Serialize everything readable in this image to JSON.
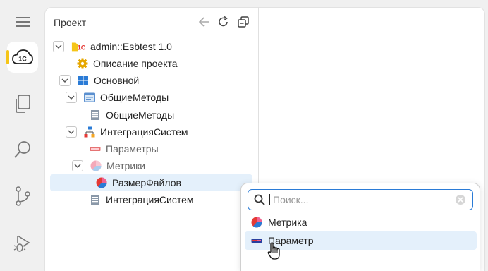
{
  "activity_bar": {
    "items": [
      {
        "name": "menu-icon"
      },
      {
        "name": "project-1c-icon",
        "label": "1C",
        "active": true
      },
      {
        "name": "files-icon"
      },
      {
        "name": "search-icon"
      },
      {
        "name": "source-control-icon"
      },
      {
        "name": "run-debug-icon"
      }
    ]
  },
  "panel": {
    "title": "Проект"
  },
  "tree": {
    "root_label": "admin::Esbtest 1.0",
    "root_badge": "1C",
    "desc_label": "Описание проекта",
    "main_label": "Основной",
    "common_methods_folder": "ОбщиеМетоды",
    "common_methods_item": "ОбщиеМетоды",
    "integration_folder": "ИнтеграцияСистем",
    "params_label": "Параметры",
    "metrics_label": "Метрики",
    "filesize_label": "РазмерФайлов",
    "integration_item": "ИнтеграцияСистем"
  },
  "popup": {
    "search_placeholder": "Поиск...",
    "search_value": "",
    "options": [
      "Метрика",
      "Параметр"
    ],
    "hovered_option": "Параметр"
  },
  "colors": {
    "accent": "#2a7bd6",
    "active_marker": "#f5c518",
    "selection": "#e4f0fb",
    "badge_red": "#e53935"
  }
}
